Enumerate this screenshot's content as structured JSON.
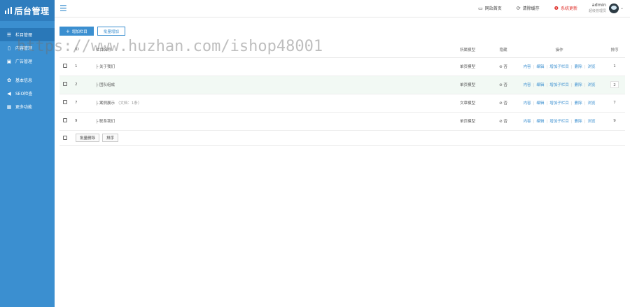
{
  "app": {
    "title": "后台管理"
  },
  "sidebar": {
    "items": [
      {
        "label": "栏目管理",
        "icon": "list-icon",
        "glyph": "☰",
        "active": true
      },
      {
        "label": "内容管理",
        "icon": "document-icon",
        "glyph": "▯",
        "active": false
      },
      {
        "label": "广告管理",
        "icon": "image-icon",
        "glyph": "▣",
        "active": false
      },
      {
        "label": "基本信息",
        "icon": "gear-icon",
        "glyph": "✿",
        "active": false
      },
      {
        "label": "SEO检查",
        "icon": "send-icon",
        "glyph": "◀",
        "active": false
      },
      {
        "label": "更多功能",
        "icon": "grid-icon",
        "glyph": "▦",
        "active": false
      }
    ]
  },
  "header": {
    "links": [
      {
        "label": "网站首页",
        "icon": "monitor-icon",
        "glyph": "▭"
      },
      {
        "label": "清除缓存",
        "icon": "refresh-icon",
        "glyph": "⟳"
      },
      {
        "label": "系统更新",
        "icon": "alert-icon",
        "glyph": "❶",
        "color": "#e0342f"
      }
    ],
    "user": {
      "name": "admin",
      "role": "超级管理员"
    }
  },
  "toolbar": {
    "add_label": "增加栏目",
    "batch_add_label": "批量增加"
  },
  "table": {
    "columns": [
      "ID",
      "栏目名称",
      "所属模型",
      "隐藏",
      "操作",
      "排序"
    ],
    "rows": [
      {
        "id": "1",
        "name": "├ 关于我们",
        "model": "单页模型",
        "hidden": "⊘ 否",
        "sort": "1",
        "hover": false
      },
      {
        "id": "2",
        "name": "├ 团队组成",
        "model": "单页模型",
        "hidden": "⊘ 否",
        "sort": "2",
        "hover": true
      },
      {
        "id": "7",
        "name": "├ 案例展示",
        "note": "（文档：1条）",
        "model": "文章模型",
        "hidden": "⊘ 否",
        "sort": "7",
        "hover": false
      },
      {
        "id": "9",
        "name": "├ 联系我们",
        "model": "单页模型",
        "hidden": "⊘ 否",
        "sort": "9",
        "hover": false
      }
    ],
    "operations": [
      "内容",
      "编辑",
      "增加子栏目",
      "删除",
      "浏览"
    ]
  },
  "footer": {
    "batch_delete_label": "批量删除",
    "sort_label": "排序"
  },
  "watermark": "https://www.huzhan.com/ishop48001",
  "colors": {
    "primary": "#3b8fd0",
    "sidebar": "#3b8fd0",
    "alert": "#e0342f"
  }
}
